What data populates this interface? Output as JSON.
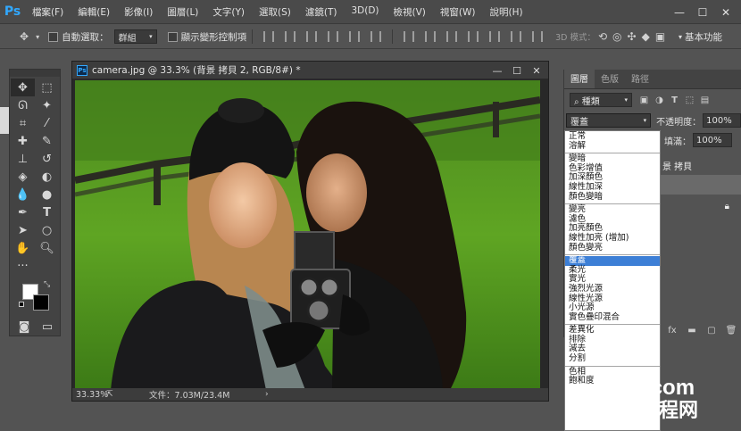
{
  "menu": {
    "items": [
      "檔案(F)",
      "編輯(E)",
      "影像(I)",
      "圖層(L)",
      "文字(Y)",
      "選取(S)",
      "濾鏡(T)",
      "3D(D)",
      "檢視(V)",
      "視窗(W)",
      "說明(H)"
    ]
  },
  "options": {
    "auto_select_label": "自動選取：",
    "auto_select_value": "群組",
    "show_transform_label": "顯示變形控制項",
    "mode3d_label": "3D 模式：",
    "workspace": "基本功能"
  },
  "document": {
    "title": "camera.jpg @ 33.3% (背景 拷貝 2, RGB/8#) *",
    "zoom": "33.33%",
    "doc_info": "文件：7.03M/23.4M"
  },
  "layers_panel": {
    "tabs": [
      "圖層",
      "色版",
      "路徑"
    ],
    "kind": "種類",
    "blend_mode": "覆蓋",
    "opacity_label": "不透明度：",
    "opacity_value": "100%",
    "fill_label": "填滿：",
    "fill_value": "100%",
    "layer_name": "景 拷貝"
  },
  "blend_modes": {
    "groups": [
      [
        "正常",
        "溶解"
      ],
      [
        "變暗",
        "色彩增值",
        "加深顏色",
        "線性加深",
        "顏色變暗"
      ],
      [
        "變亮",
        "濾色",
        "加亮顏色",
        "線性加亮 (增加)",
        "顏色變亮"
      ],
      [
        "覆蓋",
        "柔光",
        "實光",
        "強烈光源",
        "線性光源",
        "小光源",
        "實色疊印混合"
      ],
      [
        "差異化",
        "排除",
        "減去",
        "分割"
      ],
      [
        "色相",
        "飽和度"
      ]
    ],
    "selected": "覆蓋"
  },
  "watermark": {
    "line1": "fevte.com",
    "line2": "飞特教程网"
  },
  "colors": {
    "accent_blue": "#31a8ff",
    "selection_blue": "#3d7fd6"
  }
}
